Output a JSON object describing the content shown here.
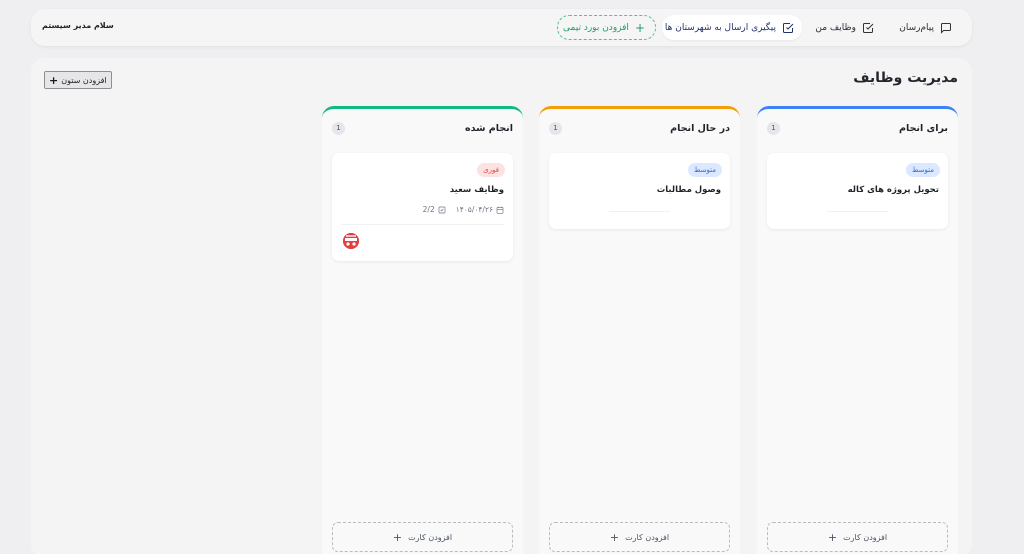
{
  "topbar": {
    "nav_messenger": "پیام‌رسان",
    "nav_my_tasks": "وظایف من",
    "nav_tracking": "پیگیری ارسال به شهرستان ها",
    "add_team_board": "افزودن بورد تیمی",
    "greeting": "سلام مدیر سیستم"
  },
  "board": {
    "title": "مدیریت وظایف",
    "add_column": "افزودن ستون",
    "add_card_label": "افزودن کارت",
    "columns": [
      {
        "title": "برای انجام",
        "count": "1",
        "color": "#3b82f6",
        "card": {
          "priority": "متوسط",
          "title": "تحویل پروژه های کاله"
        }
      },
      {
        "title": "در حال انجام",
        "count": "1",
        "color": "#f59e0b",
        "card": {
          "priority": "متوسط",
          "title": "وصول مطالبات"
        }
      },
      {
        "title": "انجام شده",
        "count": "1",
        "color": "#10b981",
        "card": {
          "priority": "فوری",
          "title": "وظایف سعید",
          "due_date": "۱۴۰۵/۰۴/۲۶",
          "checklist": "2/2"
        }
      }
    ]
  },
  "colors": {
    "accent_blue": "#3b82f6",
    "accent_orange": "#f59e0b",
    "accent_green": "#10b981",
    "badge_medium": "#2f6bd6",
    "badge_urgent": "#d94848"
  }
}
